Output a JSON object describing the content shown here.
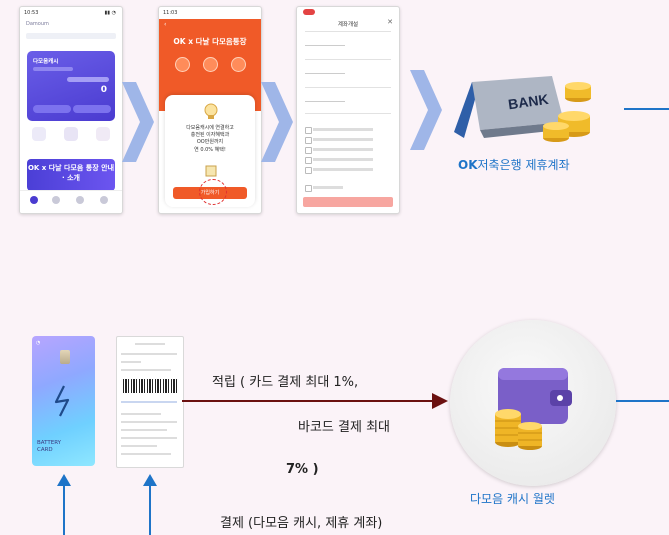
{
  "top_row": {
    "phone1": {
      "status_time": "10:53",
      "logo": "Damoum",
      "card_title": "다모음캐시",
      "balance": "0",
      "banner_text": "OK x 다날 다모음 통장 안내 · 소개"
    },
    "phone2": {
      "status_time": "11:03",
      "title": "OK x 다날 다모음통장",
      "modal_text_1": "다모음캐시에 연결하고",
      "modal_text_2": "충전된 이자혜택과",
      "modal_text_3": "OO만원까지",
      "modal_text_4": "연 0.0% 혜택!",
      "confirm_label": "가입하기"
    },
    "phone3": {
      "title": "계좌개설",
      "close_glyph": "✕"
    },
    "bank": {
      "sign_text": "BANK",
      "label_bold": "OK",
      "label_rest": "저축은행 제휴계좌"
    }
  },
  "bottom_row": {
    "card_text": "BATTERY CARD",
    "arrow_label_line1": "적립 ( 카드 결제 최대  1%,",
    "arrow_label_line2": "바코드 결제  최대",
    "arrow_label_line3": "7% )",
    "payment_label": "결제 (다모음 캐시, 제휴 계좌)",
    "wallet_label": "다모음 캐시 월렛"
  },
  "colors": {
    "chevron": "#9fb6e8",
    "accent_blue": "#1e74c8",
    "arrow_dark": "#6b1010",
    "orange": "#f05a28",
    "purple_wallet": "#7a5fc8"
  }
}
